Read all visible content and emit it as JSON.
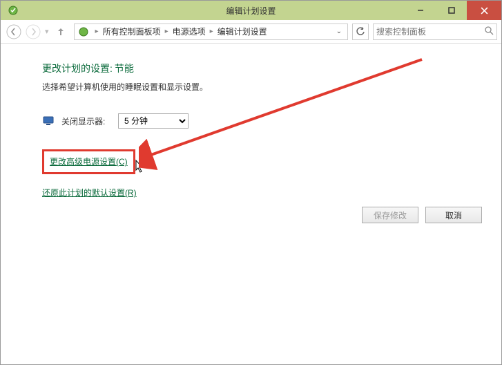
{
  "window": {
    "title": "编辑计划设置"
  },
  "navbar": {
    "breadcrumb": {
      "item1": "所有控制面板项",
      "item2": "电源选项",
      "item3": "编辑计划设置"
    },
    "search_placeholder": "搜索控制面板"
  },
  "content": {
    "heading_label": "更改计划的设置:",
    "heading_plan": "节能",
    "subtitle": "选择希望计算机使用的睡眠设置和显示设置。",
    "display_off_label": "关闭显示器:",
    "display_off_value": "5 分钟",
    "link_advanced": "更改高级电源设置(C)",
    "link_restore": "还原此计划的默认设置(R)",
    "save_button": "保存修改",
    "cancel_button": "取消"
  }
}
